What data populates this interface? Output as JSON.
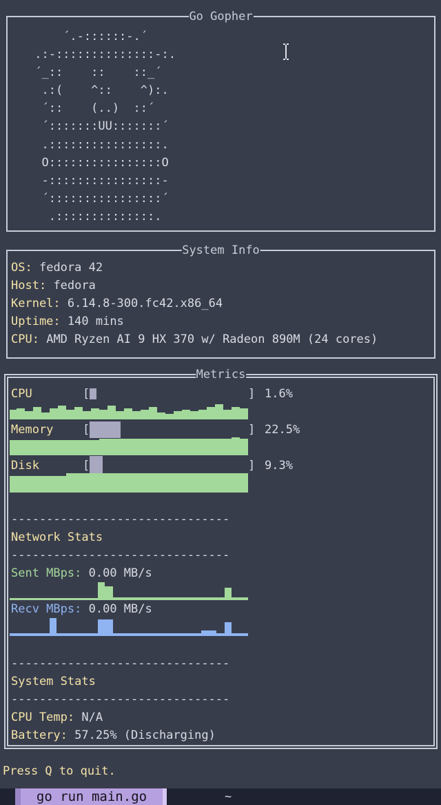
{
  "gopher": {
    "title": "Go Gopher",
    "ascii": "     ´.-::::::-.´\n .:-::::::::::::::-:.\n ´_::    ::    ::_´\n  .:(    ^::    ^):.\n  ´::    (..)  ::´\n  ´:::::::UU:::::::´\n  .::::::::::::::::.\n  O::::::::::::::::O\n  -::::::::::::::::-\n  ´::::::::::::::::´\n   .::::::::::::::."
  },
  "system_info": {
    "title": "System Info",
    "os_label": "OS:",
    "os_value": "fedora 42",
    "host_label": "Host:",
    "host_value": "fedora",
    "kernel_label": "Kernel:",
    "kernel_value": "6.14.8-300.fc42.x86_64",
    "uptime_label": "Uptime:",
    "uptime_value": "140 mins",
    "cpu_label": "CPU:",
    "cpu_value": "AMD Ryzen AI 9 HX 370 w/ Radeon 890M (24 cores)"
  },
  "metrics": {
    "title": "Metrics",
    "cpu": {
      "label": "CPU",
      "percent": "1.6%",
      "fraction": 0.016
    },
    "memory": {
      "label": "Memory",
      "percent": "22.5%",
      "fraction": 0.225
    },
    "disk": {
      "label": "Disk",
      "percent": "9.3%",
      "fraction": 0.093
    },
    "separator": "-------------------------------",
    "network_heading": "Network Stats",
    "sent_label": "Sent MBps:",
    "sent_value": "0.00 MB/s",
    "recv_label": "Recv MBps:",
    "recv_value": "0.00 MB/s",
    "system_heading": "System Stats",
    "cpu_temp_label": "CPU Temp:",
    "cpu_temp_value": "N/A",
    "battery_label": "Battery:",
    "battery_value": "57.25% (Discharging)"
  },
  "footer": {
    "quit_hint": "Press Q to quit."
  },
  "taskbar": {
    "active_tab": "go run main.go",
    "other_tab": "~"
  },
  "colors": {
    "green": "#a3d99a",
    "blue": "#8fb4f1",
    "yellow": "#f3e3a6",
    "background": "#383d4c"
  }
}
